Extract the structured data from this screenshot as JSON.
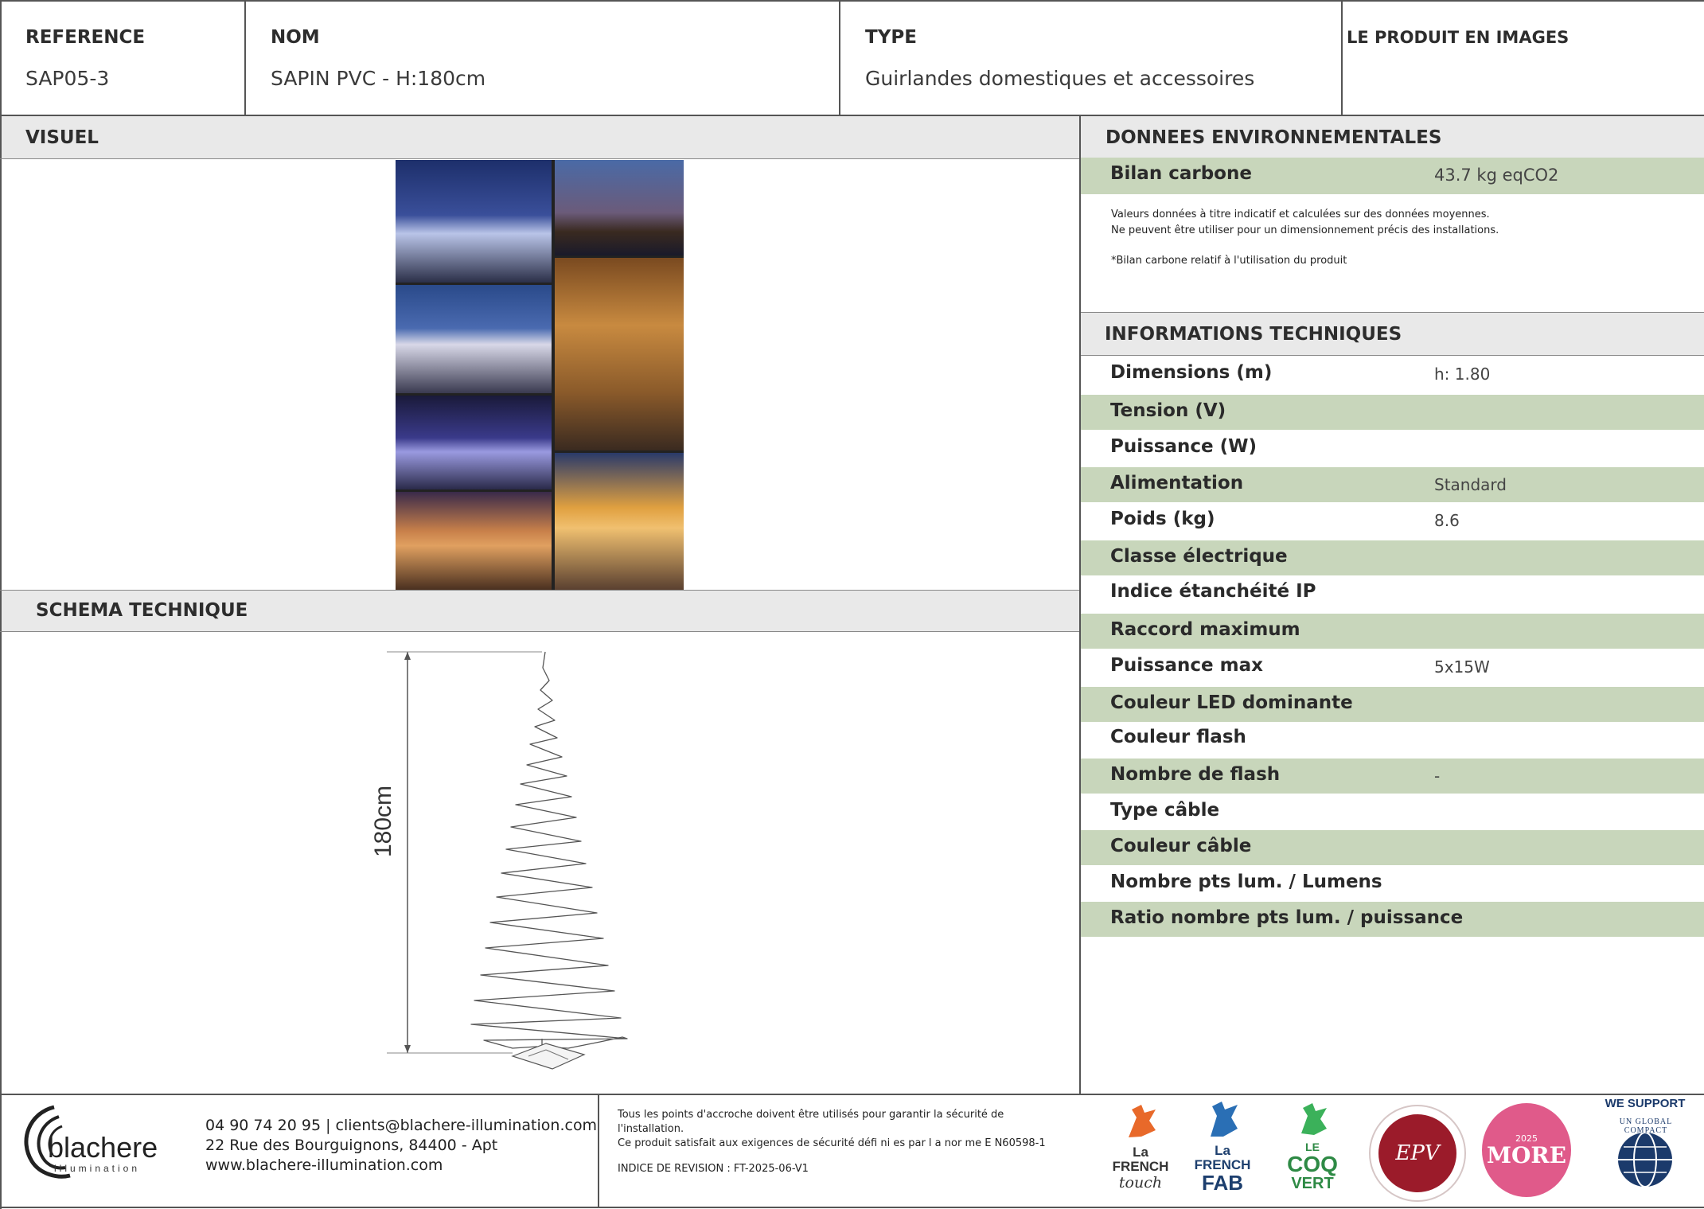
{
  "header": {
    "reference_label": "REFERENCE",
    "reference_value": "SAP05-3",
    "nom_label": "NOM",
    "nom_value": "SAPIN PVC - H:180cm",
    "type_label": "TYPE",
    "type_value": "Guirlandes domestiques et accessoires",
    "images_label": "LE PRODUIT EN IMAGES"
  },
  "sections": {
    "visuel": "VISUEL",
    "schema": "SCHEMA TECHNIQUE",
    "env": "DONNEES ENVIRONNEMENTALES",
    "tech": "INFORMATIONS TECHNIQUES"
  },
  "schema": {
    "dimension_label": "180cm"
  },
  "environment": {
    "bilan_label": "Bilan carbone",
    "bilan_value": "43.7 kg eqCO2",
    "note_line1": "Valeurs données à titre indicatif et calculées sur des données moyennes.",
    "note_line2": "Ne peuvent être utiliser pour un dimensionnement précis des installations.",
    "note_line3": "*Bilan carbone relatif à l'utilisation du produit"
  },
  "tech_rows": [
    {
      "label": "Dimensions (m)",
      "value": "h: 1.80"
    },
    {
      "label": "Tension (V)",
      "value": ""
    },
    {
      "label": "Puissance (W)",
      "value": ""
    },
    {
      "label": "Alimentation",
      "value": "Standard"
    },
    {
      "label": "Poids (kg)",
      "value": "8.6"
    },
    {
      "label": "Classe électrique",
      "value": ""
    },
    {
      "label": "Indice étanchéité IP",
      "value": ""
    },
    {
      "label": "Raccord maximum",
      "value": ""
    },
    {
      "label": "Puissance max",
      "value": "5x15W"
    },
    {
      "label": "Couleur LED dominante",
      "value": ""
    },
    {
      "label": "Couleur flash",
      "value": ""
    },
    {
      "label": "Nombre de flash",
      "value": "-"
    },
    {
      "label": "Type câble",
      "value": ""
    },
    {
      "label": "Couleur câble",
      "value": ""
    },
    {
      "label": "Nombre pts lum. / Lumens",
      "value": ""
    },
    {
      "label": "Ratio nombre pts lum. / puissance",
      "value": ""
    }
  ],
  "footer": {
    "brand": "blachere",
    "brand_sub": "illumination",
    "contact_line1": "04 90 74 20 95 | clients@blachere-illumination.com",
    "contact_line2": "22 Rue des Bourguignons, 84400 - Apt",
    "contact_line3": "www.blachere-illumination.com",
    "safety_line1": "Tous les points d'accroche doivent être utilisés pour garantir la sécurité de",
    "safety_line2": "l'installation.",
    "safety_line3": "Ce produit satisfait aux exigences de sécurité défi ni es par l a nor me E N60598-1",
    "revision": "INDICE DE REVISION : FT-2025-06-V1"
  },
  "logos": {
    "french_touch_1": "La",
    "french_touch_2": "FRENCH",
    "french_touch_3": "touch",
    "french_fab_1": "La",
    "french_fab_2": "FRENCH",
    "french_fab_3": "FAB",
    "coq_1": "LE",
    "coq_2": "COQ",
    "coq_3": "VERT",
    "epv": "EPV",
    "more": "MORE",
    "more_year": "2025",
    "un_top": "WE SUPPORT",
    "un_arc": "UN GLOBAL COMPACT"
  },
  "colors": {
    "green_band": "#c8d6bb",
    "grey_band": "#e9e9e9",
    "epv_red": "#9b1b2a",
    "more_pink": "#e05a8a",
    "un_navy": "#1b3a6b"
  }
}
